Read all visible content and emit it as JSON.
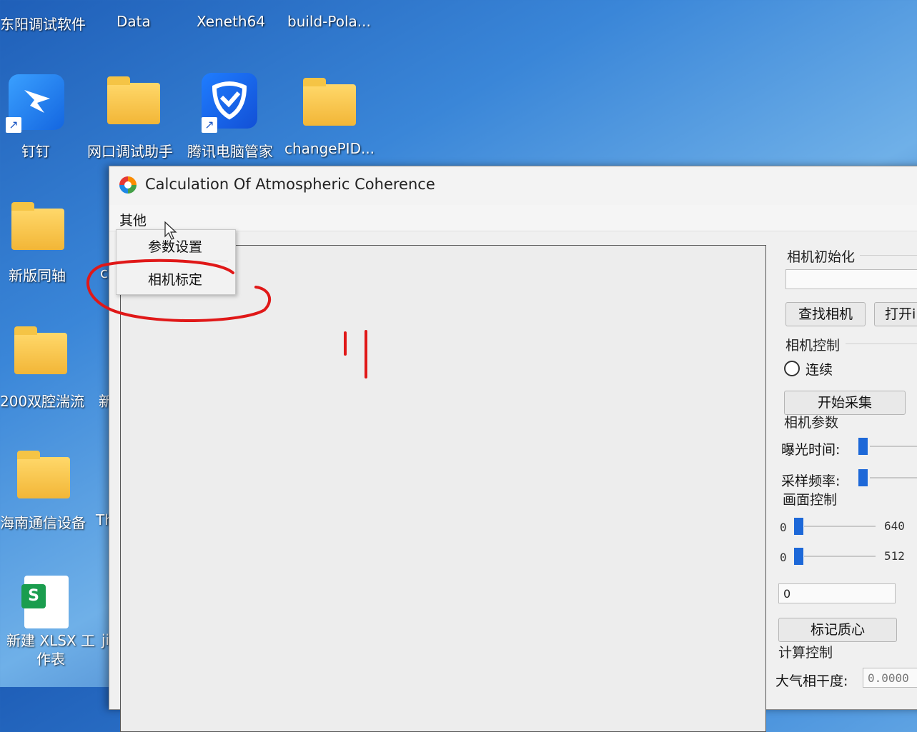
{
  "desktop": {
    "top_labels": [
      "东阳调试软件",
      "Data",
      "Xeneth64",
      "build-Pola..."
    ],
    "icons": [
      {
        "label": "钉钉",
        "icon": "dingtalk-icon"
      },
      {
        "label": "网口调试助手",
        "icon": "folder-icon"
      },
      {
        "label": "腾讯电脑管家",
        "icon": "tencent-pc-manager-icon"
      },
      {
        "label": "changePID...",
        "icon": "folder-icon"
      },
      {
        "label": "新版同轴",
        "icon": "folder-icon"
      },
      {
        "label": "200双腔湍流",
        "icon": "folder-zip-icon"
      },
      {
        "label": "海南通信设备",
        "icon": "folder-icon"
      },
      {
        "label": "新建 XLSX 工作表",
        "icon": "spreadsheet-icon"
      }
    ],
    "partial_labels": [
      "c",
      "新",
      "Th",
      "jia"
    ]
  },
  "window": {
    "title": "Calculation Of Atmospheric Coherence",
    "menu": {
      "label": "其他",
      "items": [
        "参数设置",
        "相机标定"
      ]
    },
    "panel": {
      "init_group": "相机初始化",
      "find_camera_button": "查找相机",
      "open_button": "打开i",
      "control_group": "相机控制",
      "radio_continuous": "连续",
      "start_capture_button": "开始采集",
      "params_group": "相机参数",
      "exposure_label": "曝光时间:",
      "sample_rate_label": "采样频率:",
      "frame_group": "画面控制",
      "width_min": "0",
      "width_max": "640",
      "height_min": "0",
      "height_max": "512",
      "combo_value": "0",
      "mark_centroid_button": "标记质心",
      "calc_group": "计算控制",
      "coherence_label": "大气相干度:",
      "coherence_value": "0.0000"
    }
  },
  "colors": {
    "accent": "#1d68d8",
    "annotation": "#e01818"
  }
}
